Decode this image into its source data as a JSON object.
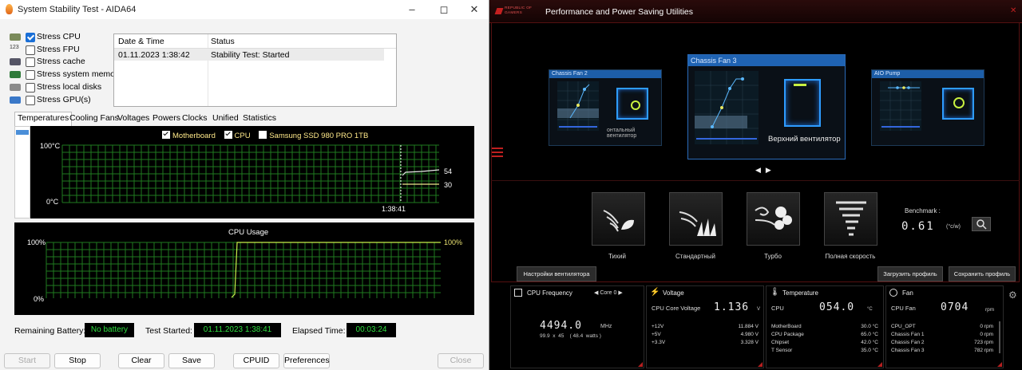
{
  "aida": {
    "title": "System Stability Test - AIDA64",
    "stress": [
      {
        "label": "Stress CPU",
        "checked": true,
        "icon": "cpu-icon"
      },
      {
        "label": "Stress FPU",
        "checked": false,
        "icon": "fpu-icon"
      },
      {
        "label": "Stress cache",
        "checked": false,
        "icon": "cache-icon"
      },
      {
        "label": "Stress system memory",
        "checked": false,
        "icon": "memory-icon"
      },
      {
        "label": "Stress local disks",
        "checked": false,
        "icon": "disk-icon"
      },
      {
        "label": "Stress GPU(s)",
        "checked": false,
        "icon": "gpu-icon"
      }
    ],
    "log": {
      "col_datetime": "Date & Time",
      "col_status": "Status",
      "rows": [
        {
          "datetime": "01.11.2023 1:38:42",
          "status": "Stability Test: Started"
        }
      ]
    },
    "tabs": [
      "Temperatures",
      "Cooling Fans",
      "Voltages",
      "Powers",
      "Clocks",
      "Unified",
      "Statistics"
    ],
    "temp_graph": {
      "legend": [
        {
          "label": "Motherboard",
          "checked": true
        },
        {
          "label": "CPU",
          "checked": true
        },
        {
          "label": "Samsung SSD 980 PRO 1TB",
          "checked": false
        }
      ],
      "y_max": "100°C",
      "y_min": "0°C",
      "time": "1:38:41",
      "value_cpu": "54",
      "value_mb": "30"
    },
    "cpu_graph": {
      "title": "CPU Usage",
      "y_max": "100%",
      "y_min": "0%",
      "value": "100%"
    },
    "status": {
      "battery_label": "Remaining Battery:",
      "battery_value": "No battery",
      "started_label": "Test Started:",
      "started_value": "01.11.2023 1:38:41",
      "elapsed_label": "Elapsed Time:",
      "elapsed_value": "00:03:24"
    },
    "buttons": {
      "start": "Start",
      "stop": "Stop",
      "clear": "Clear",
      "save": "Save",
      "cpuid": "CPUID",
      "preferences": "Preferences",
      "close": "Close"
    }
  },
  "rog": {
    "logo_text": "REPUBLIC OF GAMERS",
    "title": "Performance and Power Saving Utilities",
    "fans": [
      {
        "name": "Chassis Fan 2",
        "label": "онтальный вентилятор"
      },
      {
        "name": "Chassis Fan 3",
        "label": "Верхний вентилятор"
      },
      {
        "name": "AIO Pump",
        "label": ""
      }
    ],
    "modes": [
      "Тихий",
      "Стандартный",
      "Турбо",
      "Полная скорость"
    ],
    "benchmark": {
      "label": "Benchmark :",
      "value": "0.61",
      "unit": "(°c/w)"
    },
    "fan_settings": "Настройки вентилятора",
    "load_profile": "Загрузить профиль",
    "save_profile": "Сохранить профиль",
    "cpu_freq": {
      "title": "CPU Frequency",
      "core": "Core 0",
      "value": "4494.0",
      "unit": "MHz",
      "sub": "99.9  x  45    ( 48.4  watts )"
    },
    "voltage": {
      "title": "Voltage",
      "main_label": "CPU Core Voltage",
      "main_value": "1.136",
      "main_unit": "V",
      "rows": [
        {
          "l": "+12V",
          "v": "11.884  V"
        },
        {
          "l": "+5V",
          "v": "4.980  V"
        },
        {
          "l": "+3.3V",
          "v": "3.328  V"
        }
      ]
    },
    "temperature": {
      "title": "Temperature",
      "main_label": "CPU",
      "main_value": "054.0",
      "main_unit": "°C",
      "rows": [
        {
          "l": "MotherBoard",
          "v": "30.0 °C"
        },
        {
          "l": "CPU Package",
          "v": "65.0 °C"
        },
        {
          "l": "Chipset",
          "v": "42.0 °C"
        },
        {
          "l": "T Sensor",
          "v": "35.0 °C"
        }
      ]
    },
    "fan": {
      "title": "Fan",
      "main_label": "CPU Fan",
      "main_value": "0704",
      "main_unit": "rpm",
      "rows": [
        {
          "l": "CPU_OPT",
          "v": "0  rpm"
        },
        {
          "l": "Chassis Fan 1",
          "v": "0  rpm"
        },
        {
          "l": "Chassis Fan 2",
          "v": "723  rpm"
        },
        {
          "l": "Chassis Fan 3",
          "v": "782  rpm"
        }
      ]
    }
  }
}
